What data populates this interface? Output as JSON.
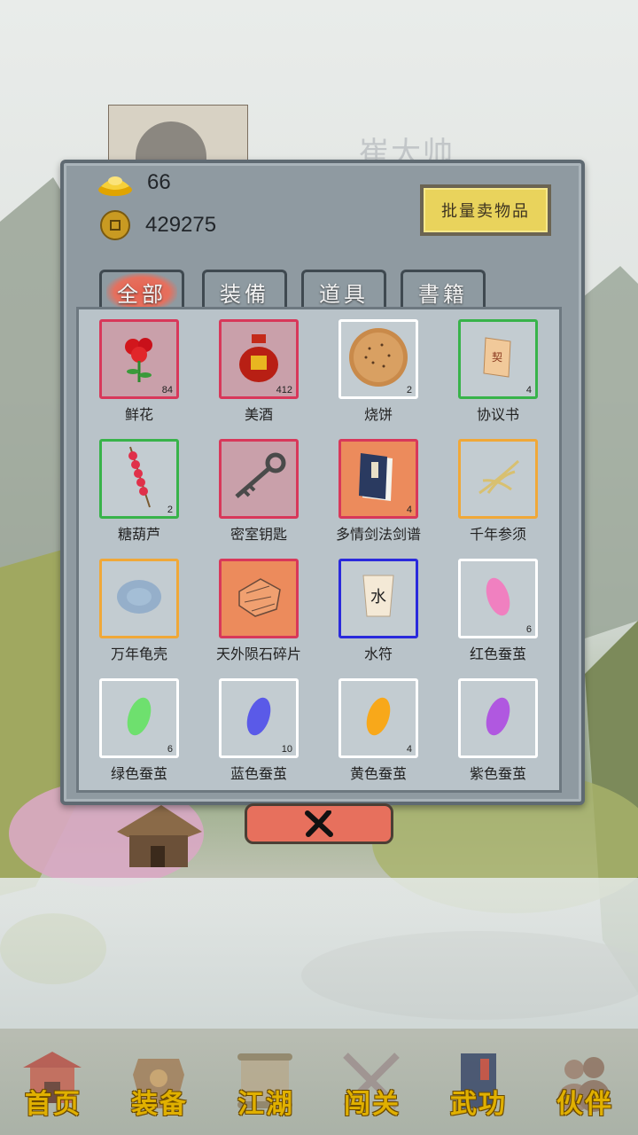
{
  "background": {
    "character_name": "崔大帅"
  },
  "currency": {
    "gold": "66",
    "coins": "429275"
  },
  "sell_button": "批量卖物品",
  "tabs": [
    {
      "label": "全部",
      "active": true
    },
    {
      "label": "装備",
      "active": false
    },
    {
      "label": "道具",
      "active": false
    },
    {
      "label": "書籍",
      "active": false
    }
  ],
  "items": [
    {
      "name": "鲜花",
      "count": "84",
      "border": "#d8385a",
      "icon": "rose-icon"
    },
    {
      "name": "美酒",
      "count": "412",
      "border": "#d8385a",
      "icon": "wine-jar-icon"
    },
    {
      "name": "烧饼",
      "count": "2",
      "border": "#ffffff",
      "icon": "flatbread-icon"
    },
    {
      "name": "协议书",
      "count": "4",
      "border": "#38b34a",
      "icon": "scroll-document-icon"
    },
    {
      "name": "糖葫芦",
      "count": "2",
      "border": "#38b34a",
      "icon": "candied-haws-icon"
    },
    {
      "name": "密室钥匙",
      "count": "",
      "border": "#d8385a",
      "icon": "key-icon"
    },
    {
      "name": "多情剑法剑谱",
      "count": "4",
      "border": "#d8385a",
      "icon": "book-icon"
    },
    {
      "name": "千年参须",
      "count": "",
      "border": "#f0a838",
      "icon": "ginseng-icon"
    },
    {
      "name": "万年龟壳",
      "count": "",
      "border": "#f0a838",
      "icon": "turtle-shell-icon"
    },
    {
      "name": "天外陨石碎片",
      "count": "",
      "border": "#d8385a",
      "icon": "meteorite-icon"
    },
    {
      "name": "水符",
      "count": "",
      "border": "#2a2adc",
      "icon": "water-talisman-icon"
    },
    {
      "name": "红色蚕茧",
      "count": "6",
      "border": "#ffffff",
      "icon": "red-cocoon-icon"
    },
    {
      "name": "绿色蚕茧",
      "count": "6",
      "border": "#ffffff",
      "icon": "green-cocoon-icon"
    },
    {
      "name": "蓝色蚕茧",
      "count": "10",
      "border": "#ffffff",
      "icon": "blue-cocoon-icon"
    },
    {
      "name": "黄色蚕茧",
      "count": "4",
      "border": "#ffffff",
      "icon": "yellow-cocoon-icon"
    },
    {
      "name": "紫色蚕茧",
      "count": "",
      "border": "#ffffff",
      "icon": "purple-cocoon-icon"
    }
  ],
  "nav": [
    {
      "label": "首页",
      "icon": "temple-icon"
    },
    {
      "label": "装备",
      "icon": "armor-icon"
    },
    {
      "label": "江湖",
      "icon": "map-scroll-icon"
    },
    {
      "label": "闯关",
      "icon": "crossed-swords-icon"
    },
    {
      "label": "武功",
      "icon": "manual-book-icon"
    },
    {
      "label": "伙伴",
      "icon": "companions-icon"
    }
  ],
  "colors": {
    "active_tab": "#e5705e",
    "sell_button": "#e9d35c",
    "close_button": "#e7705d",
    "nav_label": "#e0b000"
  }
}
